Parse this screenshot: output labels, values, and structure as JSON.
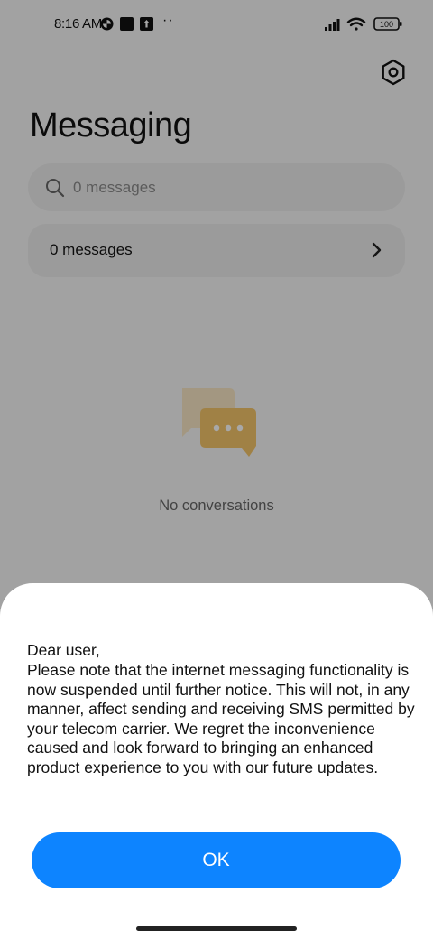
{
  "status_bar": {
    "time": "8:16 AM",
    "left_icons": [
      "data-saver-icon",
      "square-notification-icon",
      "upload-icon"
    ],
    "more_indicator": "··",
    "right_icons": [
      "signal-icon",
      "wifi-icon",
      "battery-icon"
    ],
    "battery_level": "100"
  },
  "header": {
    "title": "Messaging",
    "settings_icon": "settings-hex-icon"
  },
  "search": {
    "placeholder": "0 messages",
    "icon": "search-icon"
  },
  "messages_row": {
    "label": "0 messages",
    "icon": "chevron-right-icon"
  },
  "empty_state": {
    "icon": "chat-bubbles-icon",
    "text": "No conversations"
  },
  "dialog": {
    "greeting": "Dear user,",
    "body": "Please note that the internet messaging functionality is now suspended until further notice. This will not, in any manner, affect sending and receiving SMS permitted by your telecom carrier. We regret the inconvenience caused and look forward to bringing an enhanced product experience to you with our future updates.",
    "ok_label": "OK"
  },
  "colors": {
    "accent": "#0d84ff",
    "background": "#f6f6f6",
    "empty_icon": "#f3c46a"
  }
}
